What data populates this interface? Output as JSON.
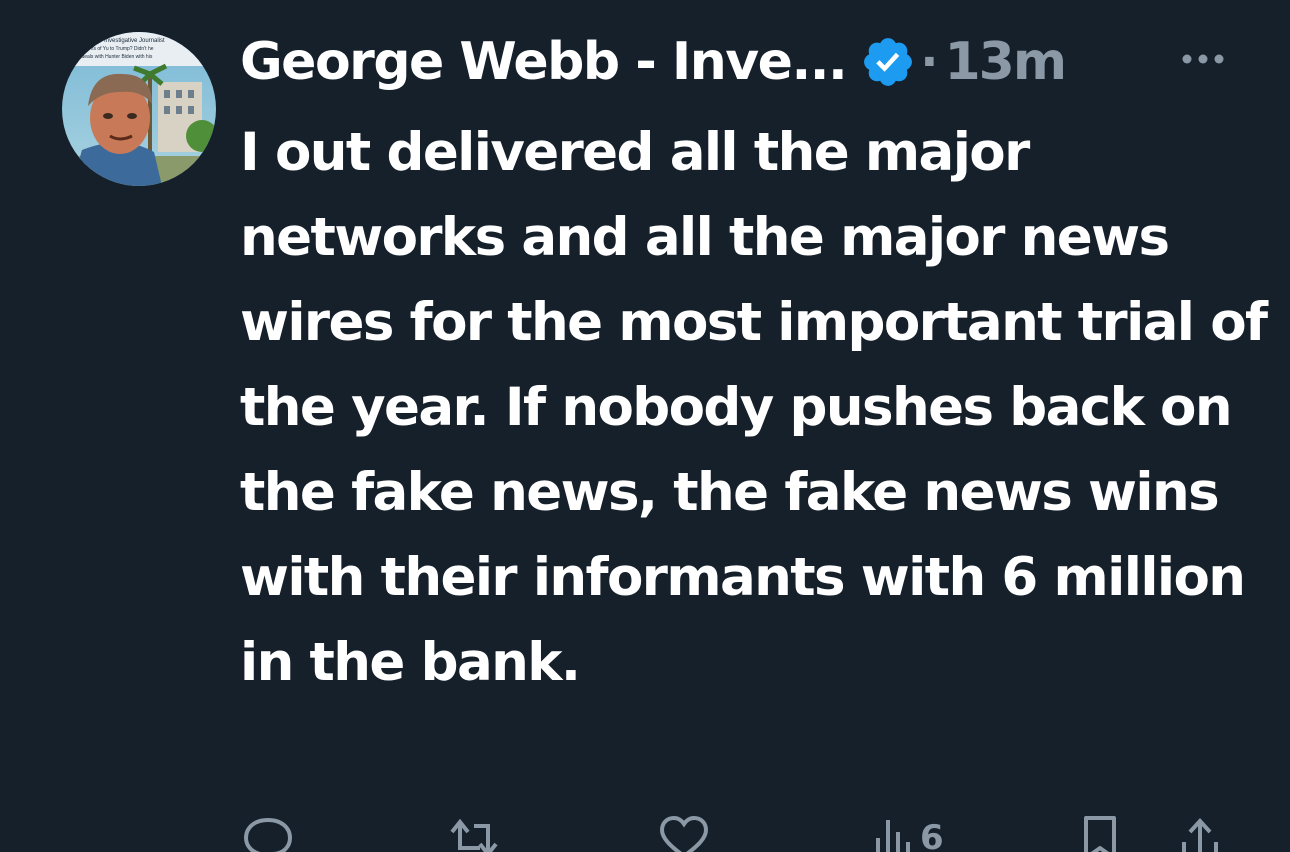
{
  "tweet": {
    "author": {
      "display_name": "George Webb - Inve...",
      "verified_icon": "verified-badge-icon",
      "avatar_caption_line1": "Investigative Journalist",
      "avatar_caption_line2": "sums of Yu to Trump? Didn't he",
      "avatar_caption_line3": "ons deals with Hunter Biden with his"
    },
    "separator": "·",
    "timestamp": "13m",
    "more_icon": "more-options-icon",
    "text": "I out delivered all the major networks and all the major news wires for the most important trial of the year. If nobody pushes back on the fake news, the fake news wins with their informants with 6 million in the bank."
  },
  "actions": {
    "reply_icon": "reply-icon",
    "retweet_icon": "retweet-icon",
    "like_icon": "like-icon",
    "views_icon": "views-icon",
    "views_count": "6",
    "bookmark_icon": "bookmark-icon",
    "share_icon": "share-icon"
  },
  "colors": {
    "background": "#15202b",
    "text_primary": "#ffffff",
    "text_secondary": "#8b98a5",
    "verified_blue": "#1d9bf0"
  }
}
